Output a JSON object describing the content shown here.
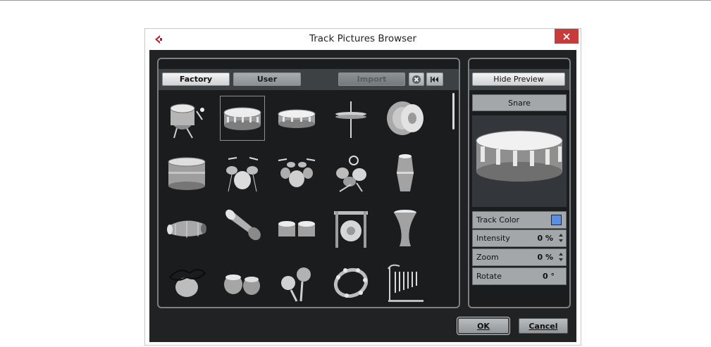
{
  "window": {
    "title": "Track Pictures Browser"
  },
  "browser": {
    "tabs": {
      "factory": "Factory",
      "user": "User"
    },
    "import_label": "Import",
    "selected_index": 1,
    "icons": [
      "tom-drum-icon",
      "snare-drum-icon",
      "piccolo-snare-icon",
      "hi-hat-icon",
      "cymbal-icon",
      "bass-drum-icon",
      "drum-kit-icon",
      "large-drum-kit-icon",
      "electronic-kit-icon",
      "conga-icon",
      "tabla-drum-icon",
      "dhol-drum-icon",
      "bongos-icon",
      "gong-icon",
      "djembe-icon",
      "shaker-icon",
      "tabla-pair-icon",
      "maracas-icon",
      "tambourine-icon",
      "chimes-icon"
    ]
  },
  "preview": {
    "hide_label": "Hide Preview",
    "selected_name": "Snare",
    "properties": {
      "track_color_label": "Track Color",
      "track_color": "#5b8de0",
      "intensity_label": "Intensity",
      "intensity_value": "0 %",
      "zoom_label": "Zoom",
      "zoom_value": "0 %",
      "rotate_label": "Rotate",
      "rotate_value": "0 °"
    }
  },
  "footer": {
    "ok_label": "OK",
    "cancel_label": "Cancel"
  },
  "colors": {
    "close": "#c83b3b",
    "panel_bg": "#1b1c1e",
    "client_bg": "#202224",
    "logo": "#b0223a"
  }
}
